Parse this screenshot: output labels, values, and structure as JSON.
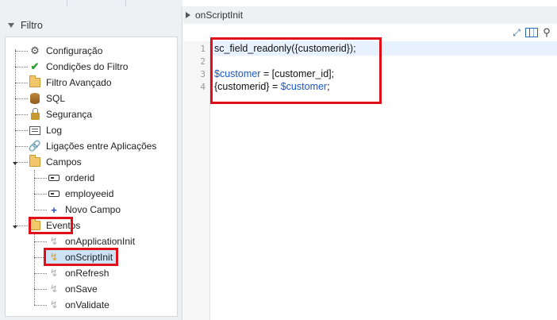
{
  "left_panel": {
    "title": "Filtro",
    "items": [
      {
        "label": "Configuração"
      },
      {
        "label": "Condições do Filtro"
      },
      {
        "label": "Filtro Avançado"
      },
      {
        "label": "SQL"
      },
      {
        "label": "Segurança"
      },
      {
        "label": "Log"
      },
      {
        "label": "Ligações entre Aplicações"
      },
      {
        "label": "Campos"
      },
      {
        "label": "orderid"
      },
      {
        "label": "employeeid"
      },
      {
        "label": "Novo Campo"
      },
      {
        "label": "Eventos"
      },
      {
        "label": "onApplicationInit"
      },
      {
        "label": "onScriptInit"
      },
      {
        "label": "onRefresh"
      },
      {
        "label": "onSave"
      },
      {
        "label": "onValidate"
      }
    ]
  },
  "editor": {
    "tab_title": "onScriptInit",
    "line_numbers": [
      "1",
      "2",
      "3",
      "4"
    ],
    "lines": {
      "l1": "sc_field_readonly({customerid});",
      "l3_var": "$customer",
      "l3_rest": " = [customer_id];",
      "l4_pre": "{customerid} = ",
      "l4_var": "$customer",
      "l4_post": ";"
    }
  },
  "colors": {
    "highlight": "#e0101a",
    "variable": "#1a56c8",
    "selection": "#cde4f7"
  }
}
